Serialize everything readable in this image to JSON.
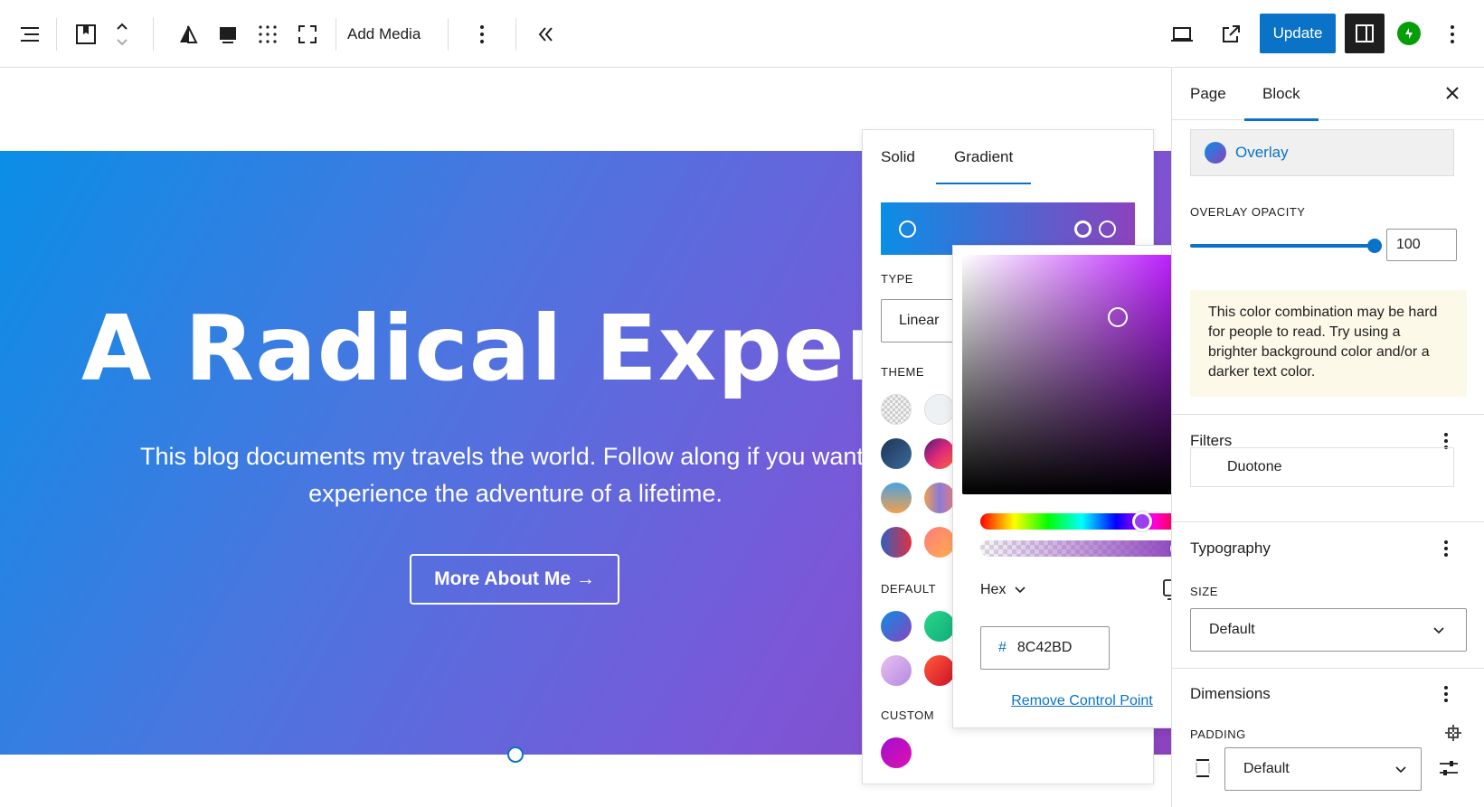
{
  "toolbar": {
    "add_media": "Add Media",
    "update": "Update"
  },
  "cover": {
    "title": "A Radical  Experience",
    "text": "This blog documents my travels the world. Follow along if you want to experience the adventure of a lifetime.",
    "button": "More About Me →"
  },
  "gradient_popover": {
    "tabs": [
      "Solid",
      "Gradient"
    ],
    "type_label": "TYPE",
    "type_value": "Linear",
    "theme_label": "THEME",
    "default_label": "DEFAULT",
    "custom_label": "CUSTOM"
  },
  "picker": {
    "format": "Hex",
    "hash": "#",
    "hex_value": "8C42BD",
    "remove": "Remove Control Point"
  },
  "sidebar": {
    "tabs": [
      "Page",
      "Block"
    ],
    "overlay": "Overlay",
    "overlay_opacity_label": "OVERLAY OPACITY",
    "overlay_opacity": "100",
    "notice": "This color combination may be hard for people to read. Try using a brighter background color and/or a darker text color.",
    "filters_head": "Filters",
    "duotone": "Duotone",
    "typography_head": "Typography",
    "size_label": "SIZE",
    "size_value": "Default",
    "dimensions_head": "Dimensions",
    "padding_label": "PADDING",
    "padding_value": "Default"
  },
  "colors": {
    "accent": "#0a73c7",
    "gradient_start": "#0a8ee6",
    "gradient_end": "#8C42BD"
  }
}
